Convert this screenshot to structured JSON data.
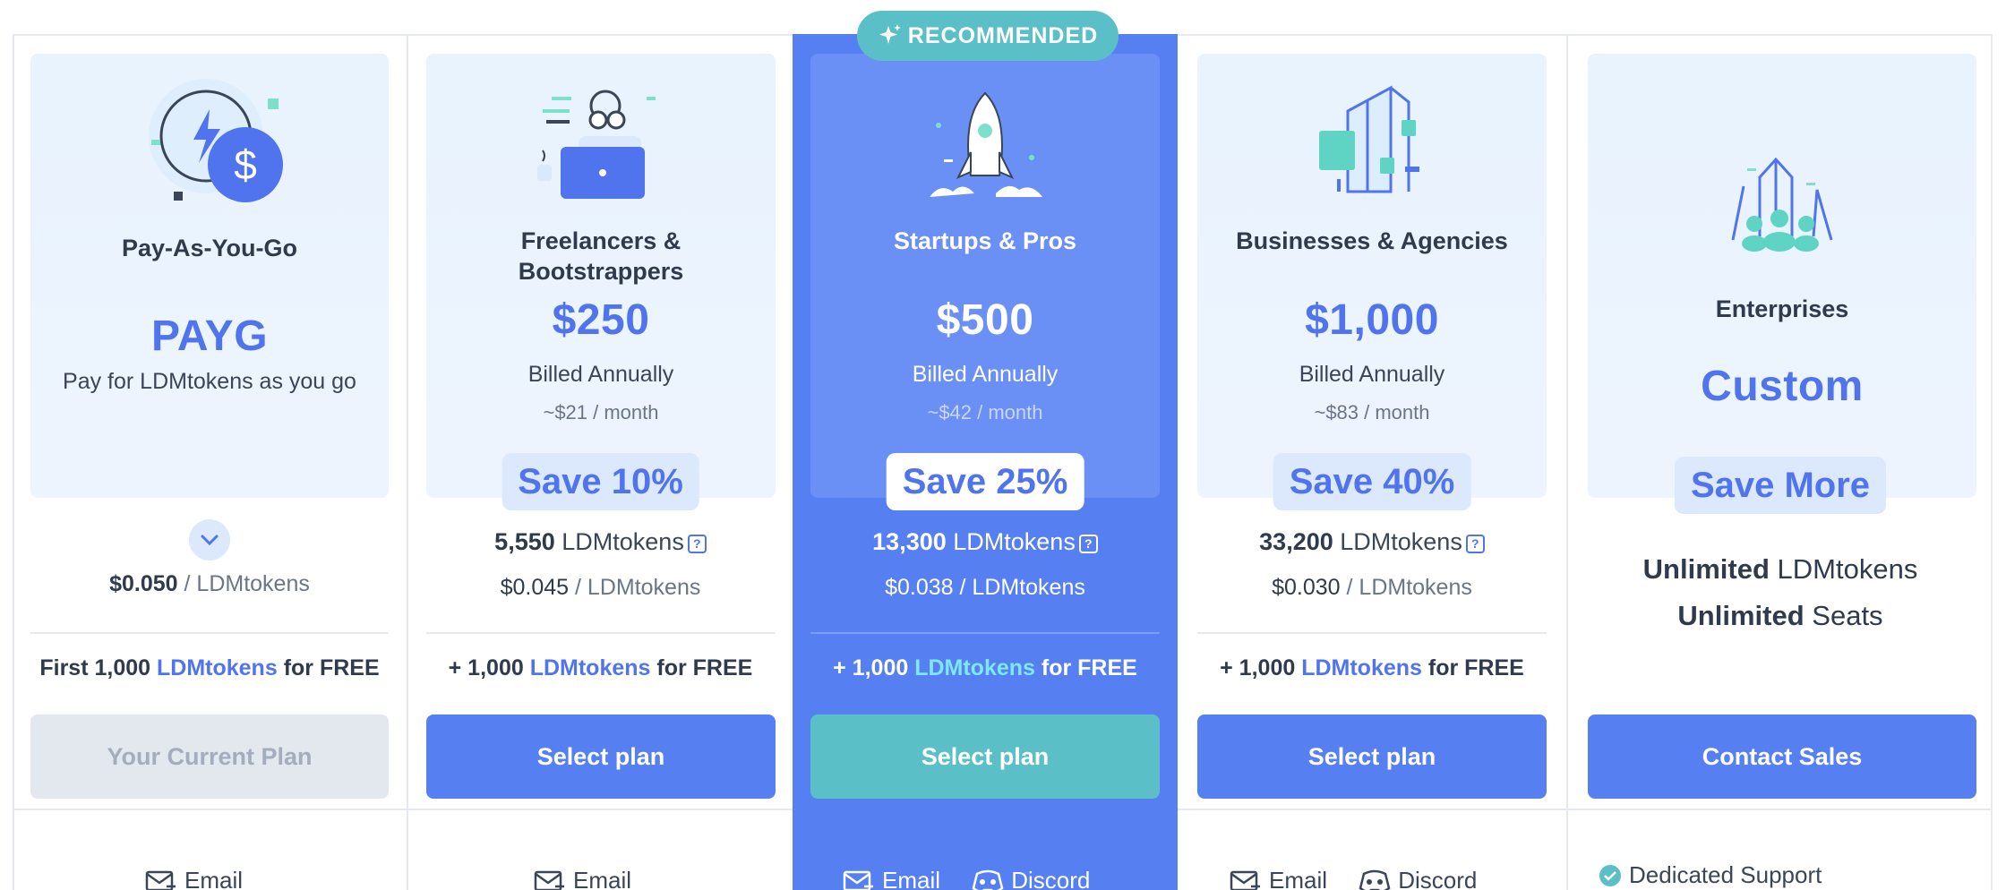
{
  "badge": "RECOMMENDED",
  "plans": [
    {
      "name": "Pay-As-You-Go",
      "price": "PAYG",
      "description": "Pay for LDMtokens as you go",
      "rate_value": "$0.050",
      "rate_unit": "/ LDMtokens",
      "free_prefix": "First 1,000",
      "free_link": "LDMtokens",
      "free_suffix": "for FREE",
      "button": "Your Current Plan",
      "support": [
        "Email"
      ]
    },
    {
      "name": "Freelancers & Bootstrappers",
      "price": "$250",
      "billed": "Billed Annually",
      "monthly": "~$21 / month",
      "save": "Save 10%",
      "tokens_value": "5,550",
      "tokens_unit": "LDMtokens",
      "rate_value": "$0.045",
      "rate_unit": "/ LDMtokens",
      "free_prefix": "+ 1,000",
      "free_link": "LDMtokens",
      "free_suffix": "for FREE",
      "button": "Select plan",
      "support": [
        "Email"
      ]
    },
    {
      "name": "Startups & Pros",
      "price": "$500",
      "billed": "Billed Annually",
      "monthly": "~$42 / month",
      "save": "Save 25%",
      "tokens_value": "13,300",
      "tokens_unit": "LDMtokens",
      "rate_value": "$0.038",
      "rate_unit": "/ LDMtokens",
      "free_prefix": "+ 1,000",
      "free_link": "LDMtokens",
      "free_suffix": "for FREE",
      "button": "Select plan",
      "support": [
        "Email",
        "Discord"
      ]
    },
    {
      "name": "Businesses & Agencies",
      "price": "$1,000",
      "billed": "Billed Annually",
      "monthly": "~$83 / month",
      "save": "Save 40%",
      "tokens_value": "33,200",
      "tokens_unit": "LDMtokens",
      "rate_value": "$0.030",
      "rate_unit": "/ LDMtokens",
      "free_prefix": "+ 1,000",
      "free_link": "LDMtokens",
      "free_suffix": "for FREE",
      "button": "Select plan",
      "support": [
        "Email",
        "Discord"
      ]
    },
    {
      "name": "Enterprises",
      "price": "Custom",
      "save": "Save More",
      "unlimited_1_bold": "Unlimited",
      "unlimited_1_rest": "LDMtokens",
      "unlimited_2_bold": "Unlimited",
      "unlimited_2_rest": "Seats",
      "button": "Contact Sales",
      "support": [
        "Dedicated Support"
      ]
    }
  ],
  "colors": {
    "accent": "#5680f2",
    "teal": "#5bbfc8",
    "highlight_link": "#7de8ef",
    "text": "#2f3a4d"
  },
  "icons": [
    "lightning-dollar-illustration",
    "freelancer-laptop-illustration",
    "rocket-illustration",
    "buildings-illustration",
    "team-illustration",
    "star-sparkle-icon",
    "chevron-down-icon",
    "question-icon",
    "email-icon",
    "discord-icon",
    "check-circle-icon"
  ]
}
